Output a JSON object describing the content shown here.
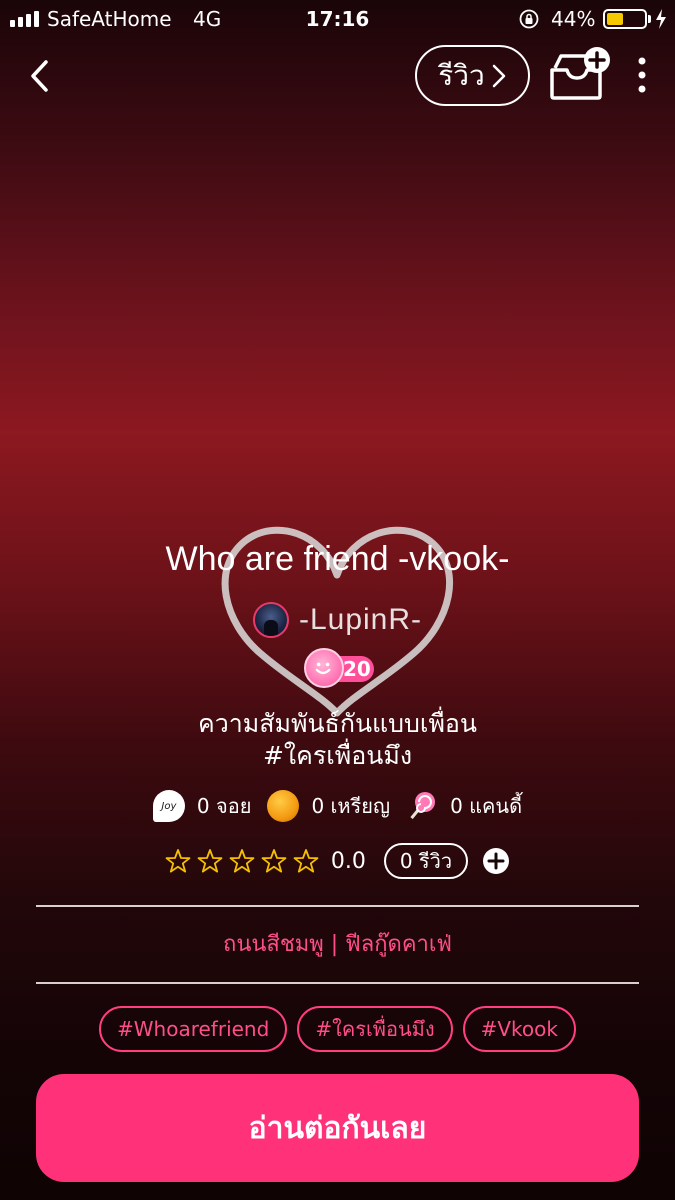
{
  "status_bar": {
    "carrier": "SafeAtHome",
    "network": "4G",
    "time": "17:16",
    "battery_percent": "44%",
    "battery_level": 0.44,
    "battery_color": "#f6c800"
  },
  "nav": {
    "back_icon": "chevron-left-icon",
    "review_label": "รีวิว",
    "add_library_icon": "inbox-plus-icon",
    "more_icon": "vertical-dots-icon"
  },
  "book": {
    "title": "Who are friend -vkook-",
    "author": "-LupinR-",
    "level": "20",
    "description_line1": "ความสัมพันธ์กันแบบเพื่อน",
    "description_line2": "#ใครเพื่อนมึง"
  },
  "stats": {
    "joy_badge": "Joy",
    "joy": "0 จอย",
    "coins": "0 เหรียญ",
    "candy": "0 แคนดี้"
  },
  "rating": {
    "stars": 0,
    "value": "0.0",
    "review_count": "0 รีวิว"
  },
  "category": "ถนนสีชมพู | ฟีลกู๊ดคาเฟ่",
  "tags": [
    "#Whoarefriend",
    "#ใครเพื่อนมึง",
    "#Vkook"
  ],
  "read_button": "อ่านต่อกันเลย",
  "colors": {
    "accent": "#ff3179",
    "tag_text": "#ff4f8a"
  }
}
